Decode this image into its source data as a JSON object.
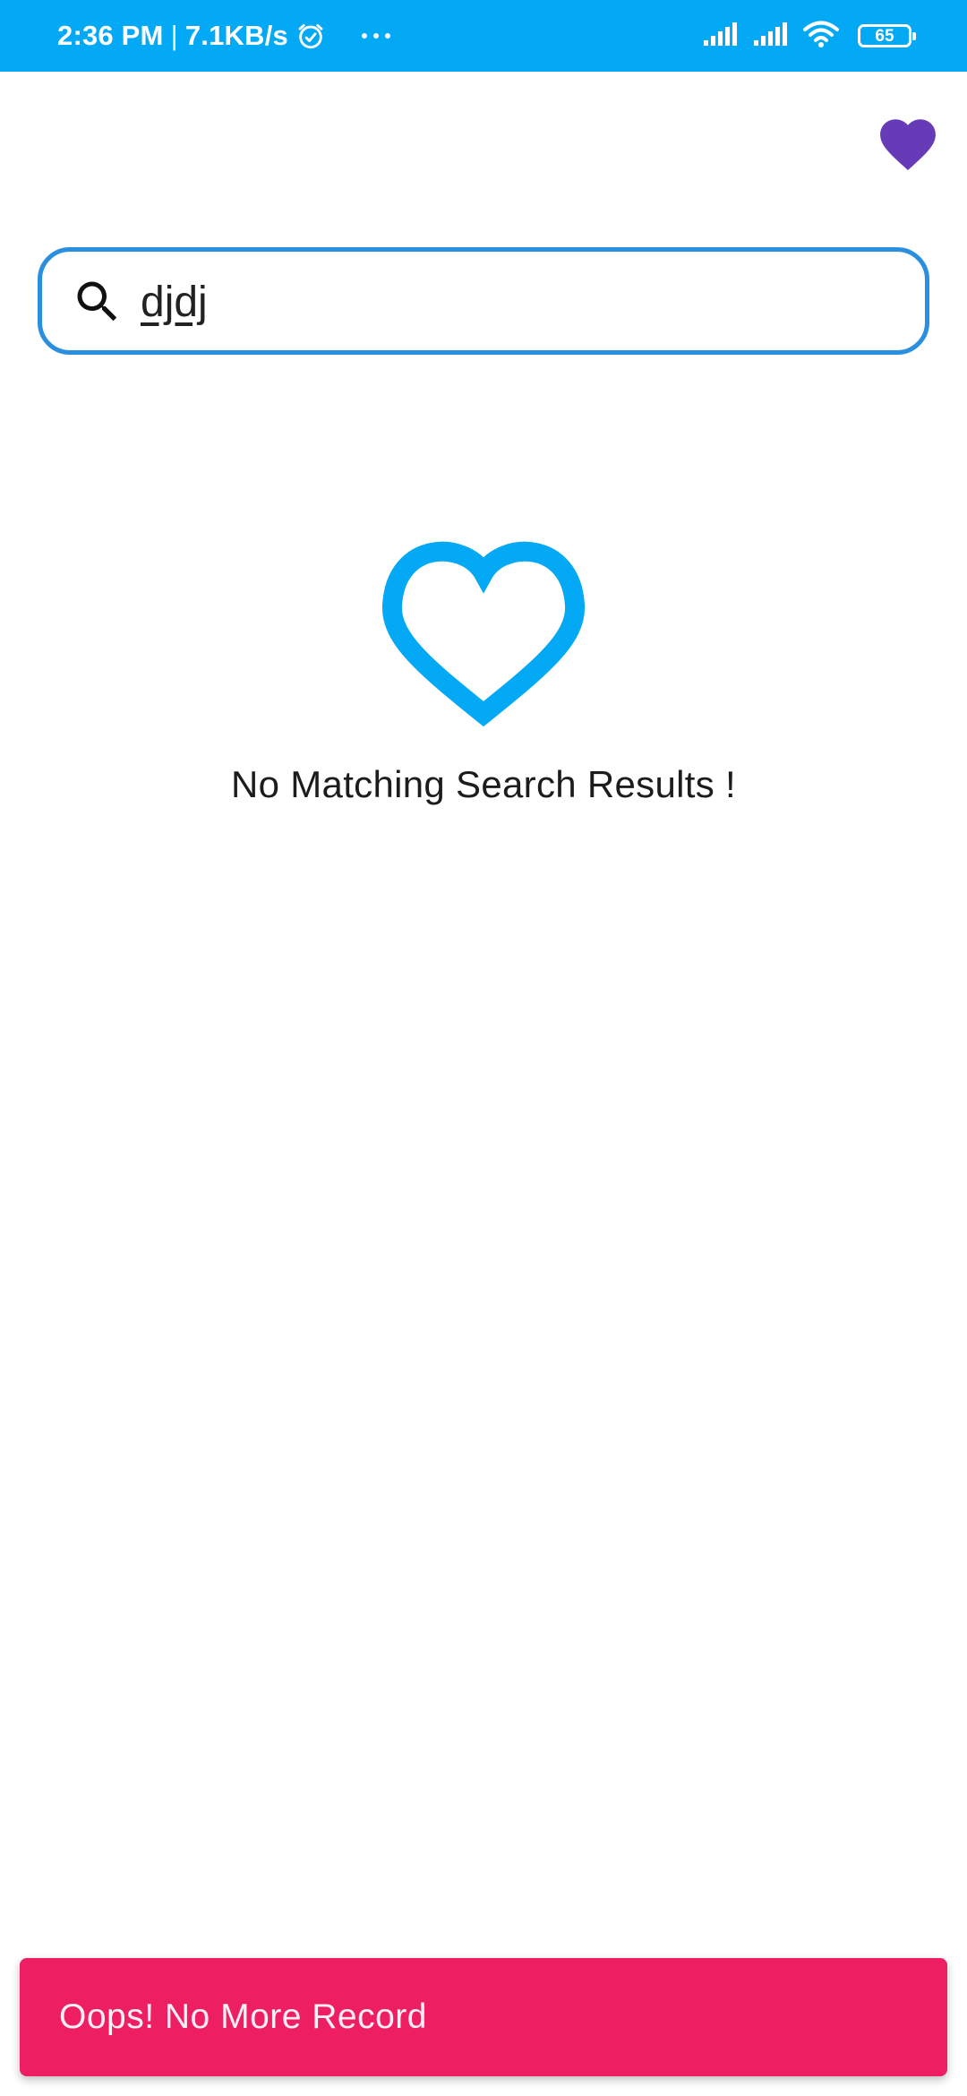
{
  "status_bar": {
    "time": "2:36 PM",
    "separator": "|",
    "net_speed": "7.1KB/s",
    "battery": "65",
    "icons": [
      "alarm-icon",
      "more-dots-icon",
      "signal-icon",
      "signal-icon",
      "wifi-icon",
      "battery-icon"
    ]
  },
  "header": {
    "favorite_icon": "heart-filled-icon",
    "favorite_color": "#673ab7"
  },
  "search": {
    "icon": "search-icon",
    "value": "djdj",
    "border_color": "#2b8fe0"
  },
  "empty_state": {
    "icon": "heart-outline-icon",
    "icon_color": "#03a9f4",
    "message": "No Matching Search Results !"
  },
  "snackbar": {
    "message": "Oops! No More Record",
    "color": "#ed1f62"
  },
  "colors": {
    "status_bar": "#03a9f4"
  }
}
